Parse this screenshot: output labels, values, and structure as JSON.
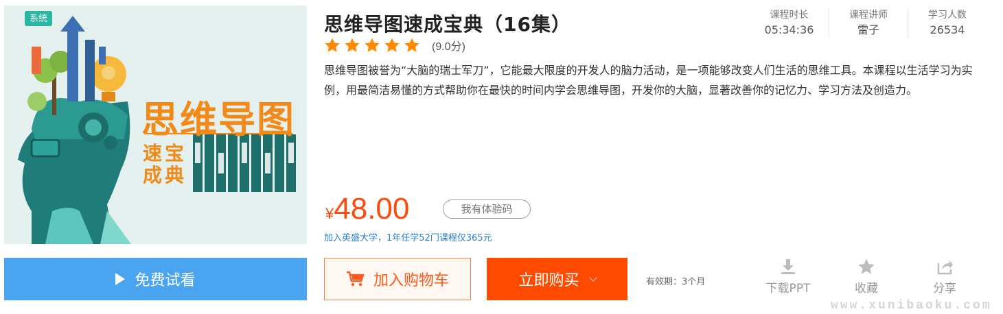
{
  "cover": {
    "badge": "系统",
    "title": "思维导图",
    "subtitle_lines": [
      "速宝",
      "成典"
    ]
  },
  "course": {
    "title": "思维导图速成宝典（16集）",
    "rating": {
      "stars": 5,
      "max": 5,
      "score_text": "(9.0分)"
    },
    "description": "思维导图被誉为“大脑的瑞士军刀”，它能最大限度的开发人的脑力活动，是一项能够改变人们生活的思维工具。本课程以生活学习为实例，用最简洁易懂的方式帮助你在最快的时间内学会思维导图，开发你的大脑，显著改善你的记忆力、学习方法及创造力。"
  },
  "stats": [
    {
      "label": "课程时长",
      "value": "05:34:36"
    },
    {
      "label": "课程讲师",
      "value": "雷子"
    },
    {
      "label": "学习人数",
      "value": "26534"
    }
  ],
  "price": {
    "currency": "¥",
    "amount": "48.00"
  },
  "coupon_label": "我有体验码",
  "promo_text": "加入英盛大学，1年任学52门课程仅365元",
  "buttons": {
    "preview": "免费试看",
    "cart": "加入购物车",
    "buy": "立即购买"
  },
  "validity": "有效期：3个月",
  "actions": {
    "ppt": "下载PPT",
    "favorite": "收藏",
    "share": "分享"
  },
  "watermark": "www.xunibaoku.com",
  "colors": {
    "accent_orange": "#ff4a00",
    "price_red": "#ff4a0d",
    "preview_blue": "#4aa4f0",
    "badge_teal": "#2bb5a3",
    "cover_orange": "#f28a1a",
    "link_blue": "#2a7fc8",
    "star_orange": "#ff8a00"
  }
}
